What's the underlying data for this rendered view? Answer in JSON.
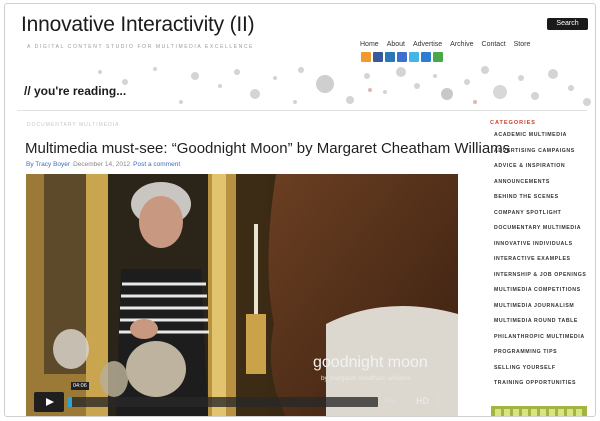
{
  "header": {
    "site_title": "Innovative Interactivity (II)",
    "tagline": "A digital content studio for multimedia excellence",
    "search_label": "Search",
    "nav": [
      "Home",
      "About",
      "Advertise",
      "Archive",
      "Contact",
      "Store"
    ],
    "social_icons": [
      {
        "name": "rss-icon",
        "color": "#f29a2e"
      },
      {
        "name": "facebook-icon",
        "color": "#3b5998"
      },
      {
        "name": "linkedin-icon",
        "color": "#2a78b8"
      },
      {
        "name": "delicious-icon",
        "color": "#3e6fd0"
      },
      {
        "name": "twitter-icon",
        "color": "#44b5e6"
      },
      {
        "name": "flickr-icon",
        "color": "#2d7dd0"
      },
      {
        "name": "email-icon",
        "color": "#4aa84a"
      }
    ]
  },
  "band": {
    "reading_label": "// you're reading..."
  },
  "post": {
    "breadcrumb": "Documentary Multimedia",
    "title": "Multimedia must-see: “Goodnight Moon” by Margaret Cheatham Williams",
    "author": "By Tracy Boyer",
    "date": "December 14, 2012",
    "comment_link": "Post a comment"
  },
  "video": {
    "title": "goodnight moon",
    "subtitle": "by margaret cheatham williams",
    "time": "04:06",
    "hd_label": "HD",
    "volume_glyph": "IIIIIIII",
    "fullscreen_glyph": "⛶",
    "progress": 0.01
  },
  "sidebar": {
    "heading": "Categories",
    "categories": [
      "Academic Multimedia",
      "Advertising Campaigns",
      "Advice & Inspiration",
      "Announcements",
      "Behind the Scenes",
      "Company Spotlight",
      "Documentary Multimedia",
      "Innovative Individuals",
      "Interactive Examples",
      "Internship & Job Openings",
      "Multimedia Competitions",
      "Multimedia Journalism",
      "Multimedia Round Table",
      "Philanthropic Multimedia",
      "Programming Tips",
      "Selling Yourself",
      "Training Opportunities"
    ]
  },
  "colors": {
    "accent_red": "#d0402c",
    "link_blue": "#3b6fb6",
    "banner_green": "#a3b540"
  }
}
